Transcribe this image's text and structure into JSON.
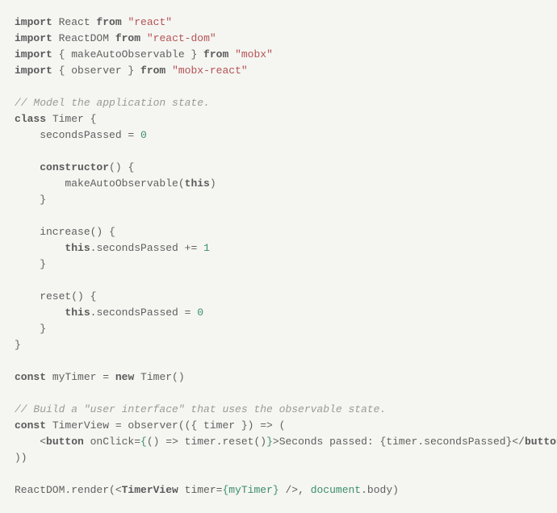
{
  "code": {
    "lines": [
      {
        "tokens": [
          [
            "kw",
            "import"
          ],
          [
            "id",
            " React "
          ],
          [
            "kw",
            "from"
          ],
          [
            "id",
            " "
          ],
          [
            "str",
            "\"react\""
          ]
        ]
      },
      {
        "tokens": [
          [
            "kw",
            "import"
          ],
          [
            "id",
            " ReactDOM "
          ],
          [
            "kw",
            "from"
          ],
          [
            "id",
            " "
          ],
          [
            "str",
            "\"react-dom\""
          ]
        ]
      },
      {
        "tokens": [
          [
            "kw",
            "import"
          ],
          [
            "id",
            " { makeAutoObservable } "
          ],
          [
            "kw",
            "from"
          ],
          [
            "id",
            " "
          ],
          [
            "str",
            "\"mobx\""
          ]
        ]
      },
      {
        "tokens": [
          [
            "kw",
            "import"
          ],
          [
            "id",
            " { observer } "
          ],
          [
            "kw",
            "from"
          ],
          [
            "id",
            " "
          ],
          [
            "str",
            "\"mobx-react\""
          ]
        ]
      },
      {
        "tokens": []
      },
      {
        "tokens": [
          [
            "com",
            "// Model the application state."
          ]
        ]
      },
      {
        "tokens": [
          [
            "kw",
            "class"
          ],
          [
            "id",
            " Timer {"
          ]
        ]
      },
      {
        "tokens": [
          [
            "id",
            "    secondsPassed = "
          ],
          [
            "num",
            "0"
          ]
        ]
      },
      {
        "tokens": []
      },
      {
        "tokens": [
          [
            "id",
            "    "
          ],
          [
            "kw",
            "constructor"
          ],
          [
            "id",
            "() {"
          ]
        ]
      },
      {
        "tokens": [
          [
            "id",
            "        makeAutoObservable("
          ],
          [
            "kw",
            "this"
          ],
          [
            "id",
            ")"
          ]
        ]
      },
      {
        "tokens": [
          [
            "id",
            "    }"
          ]
        ]
      },
      {
        "tokens": []
      },
      {
        "tokens": [
          [
            "id",
            "    increase() {"
          ]
        ]
      },
      {
        "tokens": [
          [
            "id",
            "        "
          ],
          [
            "kw",
            "this"
          ],
          [
            "id",
            ".secondsPassed += "
          ],
          [
            "num",
            "1"
          ]
        ]
      },
      {
        "tokens": [
          [
            "id",
            "    }"
          ]
        ]
      },
      {
        "tokens": []
      },
      {
        "tokens": [
          [
            "id",
            "    reset() {"
          ]
        ]
      },
      {
        "tokens": [
          [
            "id",
            "        "
          ],
          [
            "kw",
            "this"
          ],
          [
            "id",
            ".secondsPassed = "
          ],
          [
            "num",
            "0"
          ]
        ]
      },
      {
        "tokens": [
          [
            "id",
            "    }"
          ]
        ]
      },
      {
        "tokens": [
          [
            "id",
            "}"
          ]
        ]
      },
      {
        "tokens": []
      },
      {
        "tokens": [
          [
            "kw",
            "const"
          ],
          [
            "id",
            " myTimer = "
          ],
          [
            "kw",
            "new"
          ],
          [
            "id",
            " Timer()"
          ]
        ]
      },
      {
        "tokens": []
      },
      {
        "tokens": [
          [
            "com",
            "// Build a \"user interface\" that uses the observable state."
          ]
        ]
      },
      {
        "tokens": [
          [
            "kw",
            "const"
          ],
          [
            "id",
            " TimerView = observer(({ timer }) => ("
          ]
        ]
      },
      {
        "tokens": [
          [
            "id",
            "    <"
          ],
          [
            "tag",
            "button"
          ],
          [
            "id",
            " onClick="
          ],
          [
            "lit",
            "{"
          ],
          [
            "id",
            "() => timer.reset()"
          ],
          [
            "lit",
            "}"
          ],
          [
            "id",
            ">Seconds passed: {timer.secondsPassed}</"
          ],
          [
            "tag",
            "button"
          ],
          [
            "id",
            ">"
          ]
        ]
      },
      {
        "tokens": [
          [
            "id",
            "))"
          ]
        ]
      },
      {
        "tokens": []
      },
      {
        "tokens": [
          [
            "id",
            "ReactDOM.render(<"
          ],
          [
            "tag",
            "TimerView"
          ],
          [
            "id",
            " timer="
          ],
          [
            "lit",
            "{myTimer}"
          ],
          [
            "id",
            " />, "
          ],
          [
            "lit",
            "document"
          ],
          [
            "id",
            ".body)"
          ]
        ]
      }
    ]
  }
}
